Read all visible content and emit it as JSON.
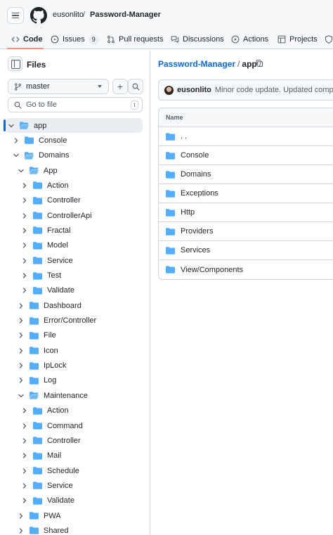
{
  "header": {
    "owner": "eusonlito",
    "separator": "/",
    "repo": "Password-Manager",
    "tabs": [
      {
        "label": "Code",
        "icon": "code-icon",
        "active": true
      },
      {
        "label": "Issues",
        "icon": "issue-icon",
        "count": "9"
      },
      {
        "label": "Pull requests",
        "icon": "pull-request-icon"
      },
      {
        "label": "Discussions",
        "icon": "discussions-icon"
      },
      {
        "label": "Actions",
        "icon": "actions-icon"
      },
      {
        "label": "Projects",
        "icon": "projects-icon"
      }
    ]
  },
  "sidebar": {
    "title": "Files",
    "branch": "master",
    "goto_placeholder": "Go to file",
    "goto_shortcut": "t",
    "tree": [
      {
        "label": "app",
        "depth": 0,
        "expanded": true,
        "selected": true
      },
      {
        "label": "Console",
        "depth": 1,
        "expanded": false
      },
      {
        "label": "Domains",
        "depth": 1,
        "expanded": true
      },
      {
        "label": "App",
        "depth": 2,
        "expanded": true
      },
      {
        "label": "Action",
        "depth": 3,
        "expanded": false
      },
      {
        "label": "Controller",
        "depth": 3,
        "expanded": false
      },
      {
        "label": "ControllerApi",
        "depth": 3,
        "expanded": false
      },
      {
        "label": "Fractal",
        "depth": 3,
        "expanded": false
      },
      {
        "label": "Model",
        "depth": 3,
        "expanded": false
      },
      {
        "label": "Service",
        "depth": 3,
        "expanded": false
      },
      {
        "label": "Test",
        "depth": 3,
        "expanded": false
      },
      {
        "label": "Validate",
        "depth": 3,
        "expanded": false
      },
      {
        "label": "Dashboard",
        "depth": 2,
        "expanded": false
      },
      {
        "label": "Error/Controller",
        "depth": 2,
        "expanded": false
      },
      {
        "label": "File",
        "depth": 2,
        "expanded": false
      },
      {
        "label": "Icon",
        "depth": 2,
        "expanded": false
      },
      {
        "label": "IpLock",
        "depth": 2,
        "expanded": false
      },
      {
        "label": "Log",
        "depth": 2,
        "expanded": false
      },
      {
        "label": "Maintenance",
        "depth": 2,
        "expanded": true
      },
      {
        "label": "Action",
        "depth": 3,
        "expanded": false
      },
      {
        "label": "Command",
        "depth": 3,
        "expanded": false
      },
      {
        "label": "Controller",
        "depth": 3,
        "expanded": false
      },
      {
        "label": "Mail",
        "depth": 3,
        "expanded": false
      },
      {
        "label": "Schedule",
        "depth": 3,
        "expanded": false
      },
      {
        "label": "Service",
        "depth": 3,
        "expanded": false
      },
      {
        "label": "Validate",
        "depth": 3,
        "expanded": false
      },
      {
        "label": "PWA",
        "depth": 2,
        "expanded": false
      },
      {
        "label": "Shared",
        "depth": 2,
        "expanded": false
      }
    ]
  },
  "main": {
    "path_repo": "Password-Manager",
    "path_dir": "app",
    "path_sep": "/",
    "commit_author": "eusonlito",
    "commit_message": "Minor code update. Updated composer p",
    "table_header": "Name",
    "rows": [
      ". .",
      "Console",
      "Domains",
      "Exceptions",
      "Http",
      "Providers",
      "Services",
      "View/Components"
    ]
  },
  "colors": {
    "accent": "#0969da",
    "folder": "#54aeff",
    "tab_underline": "#fd8c73"
  }
}
